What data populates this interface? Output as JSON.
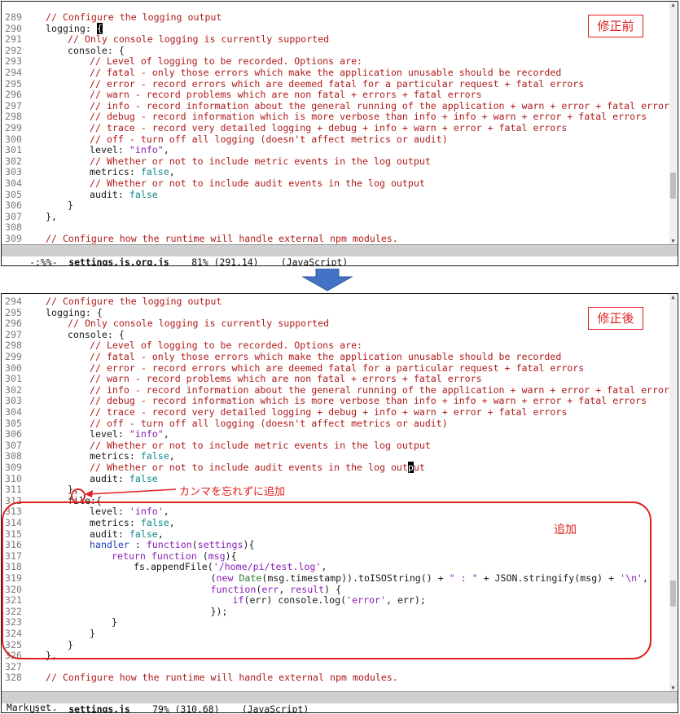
{
  "before": {
    "tag": "修正前",
    "lines": [
      {
        "n": "289",
        "segs": [
          [
            "c",
            "// Configure the logging output"
          ]
        ],
        "indent": 0
      },
      {
        "n": "290",
        "segs": [
          [
            "",
            "logging: "
          ],
          [
            "cursor",
            "{"
          ]
        ],
        "indent": 0
      },
      {
        "n": "291",
        "segs": [
          [
            "c",
            "// Only console logging is currently supported"
          ]
        ],
        "indent": 4
      },
      {
        "n": "292",
        "segs": [
          [
            "",
            "console: {"
          ]
        ],
        "indent": 4
      },
      {
        "n": "293",
        "segs": [
          [
            "c",
            "// Level of logging to be recorded. Options are:"
          ]
        ],
        "indent": 8
      },
      {
        "n": "294",
        "segs": [
          [
            "c",
            "// fatal - only those errors which make the application unusable should be recorded"
          ]
        ],
        "indent": 8
      },
      {
        "n": "295",
        "segs": [
          [
            "c",
            "// error - record errors which are deemed fatal for a particular request + fatal errors"
          ]
        ],
        "indent": 8
      },
      {
        "n": "296",
        "segs": [
          [
            "c",
            "// warn - record problems which are non fatal + errors + fatal errors"
          ]
        ],
        "indent": 8
      },
      {
        "n": "297",
        "segs": [
          [
            "c",
            "// info - record information about the general running of the application + warn + error + fatal errors"
          ]
        ],
        "indent": 8
      },
      {
        "n": "298",
        "segs": [
          [
            "c",
            "// debug - record information which is more verbose than info + info + warn + error + fatal errors"
          ]
        ],
        "indent": 8
      },
      {
        "n": "299",
        "segs": [
          [
            "c",
            "// trace - record very detailed logging + debug + info + warn + error + fatal errors"
          ]
        ],
        "indent": 8
      },
      {
        "n": "300",
        "segs": [
          [
            "c",
            "// off - turn off all logging (doesn't affect metrics or audit)"
          ]
        ],
        "indent": 8
      },
      {
        "n": "301",
        "segs": [
          [
            "",
            "level: "
          ],
          [
            "s",
            "\"info\""
          ],
          [
            "",
            ","
          ]
        ],
        "indent": 8
      },
      {
        "n": "302",
        "segs": [
          [
            "c",
            "// Whether or not to include metric events in the log output"
          ]
        ],
        "indent": 8
      },
      {
        "n": "303",
        "segs": [
          [
            "",
            "metrics: "
          ],
          [
            "b",
            "false"
          ],
          [
            "",
            ","
          ]
        ],
        "indent": 8
      },
      {
        "n": "304",
        "segs": [
          [
            "c",
            "// Whether or not to include audit events in the log output"
          ]
        ],
        "indent": 8
      },
      {
        "n": "305",
        "segs": [
          [
            "",
            "audit: "
          ],
          [
            "b",
            "false"
          ]
        ],
        "indent": 8
      },
      {
        "n": "306",
        "segs": [
          [
            "",
            "}"
          ]
        ],
        "indent": 4
      },
      {
        "n": "307",
        "segs": [
          [
            "",
            "},"
          ]
        ],
        "indent": 0
      },
      {
        "n": "308",
        "segs": [],
        "indent": 0
      },
      {
        "n": "309",
        "segs": [
          [
            "c",
            "// Configure how the runtime will handle external npm modules."
          ]
        ],
        "indent": 0
      }
    ],
    "modeline": {
      "status": " -:%%-  ",
      "file": "settings.js.org.js",
      "pos": "    81% (291,14)    ",
      "mode": "(JavaScript)"
    }
  },
  "after": {
    "tag": "修正後",
    "lines": [
      {
        "n": "294",
        "segs": [
          [
            "c",
            "// Configure the logging output"
          ]
        ],
        "indent": 0
      },
      {
        "n": "295",
        "segs": [
          [
            "",
            "logging: {"
          ]
        ],
        "indent": 0
      },
      {
        "n": "296",
        "segs": [
          [
            "c",
            "// Only console logging is currently supported"
          ]
        ],
        "indent": 4
      },
      {
        "n": "297",
        "segs": [
          [
            "",
            "console: {"
          ]
        ],
        "indent": 4
      },
      {
        "n": "298",
        "segs": [
          [
            "c",
            "// Level of logging to be recorded. Options are:"
          ]
        ],
        "indent": 8
      },
      {
        "n": "299",
        "segs": [
          [
            "c",
            "// fatal - only those errors which make the application unusable should be recorded"
          ]
        ],
        "indent": 8
      },
      {
        "n": "300",
        "segs": [
          [
            "c",
            "// error - record errors which are deemed fatal for a particular request + fatal errors"
          ]
        ],
        "indent": 8
      },
      {
        "n": "301",
        "segs": [
          [
            "c",
            "// warn - record problems which are non fatal + errors + fatal errors"
          ]
        ],
        "indent": 8
      },
      {
        "n": "302",
        "segs": [
          [
            "c",
            "// info - record information about the general running of the application + warn + error + fatal errors"
          ]
        ],
        "indent": 8
      },
      {
        "n": "303",
        "segs": [
          [
            "c",
            "// debug - record information which is more verbose than info + info + warn + error + fatal errors"
          ]
        ],
        "indent": 8
      },
      {
        "n": "304",
        "segs": [
          [
            "c",
            "// trace - record very detailed logging + debug + info + warn + error + fatal errors"
          ]
        ],
        "indent": 8
      },
      {
        "n": "305",
        "segs": [
          [
            "c",
            "// off - turn off all logging (doesn't affect metrics or audit)"
          ]
        ],
        "indent": 8
      },
      {
        "n": "306",
        "segs": [
          [
            "",
            "level: "
          ],
          [
            "s",
            "\"info\""
          ],
          [
            "",
            ","
          ]
        ],
        "indent": 8
      },
      {
        "n": "307",
        "segs": [
          [
            "c",
            "// Whether or not to include metric events in the log output"
          ]
        ],
        "indent": 8
      },
      {
        "n": "308",
        "segs": [
          [
            "",
            "metrics: "
          ],
          [
            "b",
            "false"
          ],
          [
            "",
            ","
          ]
        ],
        "indent": 8
      },
      {
        "n": "309",
        "segs": [
          [
            "c",
            "// Whether or not to include audit events in the log out"
          ],
          [
            "cursor",
            "p"
          ],
          [
            "c",
            "ut"
          ]
        ],
        "indent": 8
      },
      {
        "n": "310",
        "segs": [
          [
            "",
            "audit: "
          ],
          [
            "b",
            "false"
          ]
        ],
        "indent": 8
      },
      {
        "n": "311",
        "segs": [
          [
            "",
            "},"
          ]
        ],
        "indent": 4
      },
      {
        "n": "312",
        "segs": [
          [
            "",
            "file:{"
          ]
        ],
        "indent": 4
      },
      {
        "n": "313",
        "segs": [
          [
            "",
            "level: "
          ],
          [
            "s",
            "'info'"
          ],
          [
            "",
            ","
          ]
        ],
        "indent": 8
      },
      {
        "n": "314",
        "segs": [
          [
            "",
            "metrics: "
          ],
          [
            "b",
            "false"
          ],
          [
            "",
            ","
          ]
        ],
        "indent": 8
      },
      {
        "n": "315",
        "segs": [
          [
            "",
            "audit: "
          ],
          [
            "b",
            "false"
          ],
          [
            "",
            ","
          ]
        ],
        "indent": 8
      },
      {
        "n": "316",
        "segs": [
          [
            "f",
            "handler"
          ],
          [
            "",
            " : "
          ],
          [
            "k",
            "function"
          ],
          [
            "",
            "("
          ],
          [
            "s",
            "settings"
          ],
          [
            "",
            "){"
          ]
        ],
        "indent": 8
      },
      {
        "n": "317",
        "segs": [
          [
            "k",
            "return"
          ],
          [
            "",
            " "
          ],
          [
            "k",
            "function"
          ],
          [
            "",
            " ("
          ],
          [
            "s",
            "msg"
          ],
          [
            "",
            "){"
          ]
        ],
        "indent": 12
      },
      {
        "n": "318",
        "segs": [
          [
            "",
            "fs.appendFile("
          ],
          [
            "s",
            "'/home/pi/test.log'"
          ],
          [
            "",
            ","
          ]
        ],
        "indent": 16
      },
      {
        "n": "319",
        "segs": [
          [
            "",
            "("
          ],
          [
            "k",
            "new"
          ],
          [
            "",
            " "
          ],
          [
            "t",
            "Date"
          ],
          [
            "",
            "(msg.timestamp)).toISOString() + "
          ],
          [
            "s",
            "\" : \""
          ],
          [
            "",
            " + JSON.stringify(msg) + "
          ],
          [
            "s",
            "'\\n'"
          ],
          [
            "",
            ","
          ]
        ],
        "indent": 30
      },
      {
        "n": "320",
        "segs": [
          [
            "k",
            "function"
          ],
          [
            "",
            "("
          ],
          [
            "s",
            "err"
          ],
          [
            "",
            ", "
          ],
          [
            "s",
            "result"
          ],
          [
            "",
            ") {"
          ]
        ],
        "indent": 30
      },
      {
        "n": "321",
        "segs": [
          [
            "k",
            "if"
          ],
          [
            "",
            "(err) console.log("
          ],
          [
            "s",
            "'error'"
          ],
          [
            "",
            ", err);"
          ]
        ],
        "indent": 34
      },
      {
        "n": "322",
        "segs": [
          [
            "",
            "});"
          ]
        ],
        "indent": 30
      },
      {
        "n": "323",
        "segs": [
          [
            "",
            "}"
          ]
        ],
        "indent": 12
      },
      {
        "n": "324",
        "segs": [
          [
            "",
            "}"
          ]
        ],
        "indent": 8
      },
      {
        "n": "325",
        "segs": [
          [
            "",
            "}"
          ]
        ],
        "indent": 4
      },
      {
        "n": "326",
        "segs": [
          [
            "",
            "},"
          ]
        ],
        "indent": 0
      },
      {
        "n": "327",
        "segs": [],
        "indent": 0
      },
      {
        "n": "328",
        "segs": [
          [
            "c",
            "// Configure how the runtime will handle external npm modules."
          ]
        ],
        "indent": 0
      }
    ],
    "modeline": {
      "status": " U:---  ",
      "file": "settings.js",
      "pos": "    79% (310,68)    ",
      "mode": "(JavaScript)"
    },
    "minibuffer": "Mark set",
    "annotation_comma": "カンマを忘れずに追加",
    "annotation_added": "追加"
  },
  "colors": {
    "accent": "#e02020",
    "arrow": "#4472c4",
    "comment": "#b11a1a",
    "keyword": "#8a1fb8",
    "builtin": "#0e8a8a"
  }
}
